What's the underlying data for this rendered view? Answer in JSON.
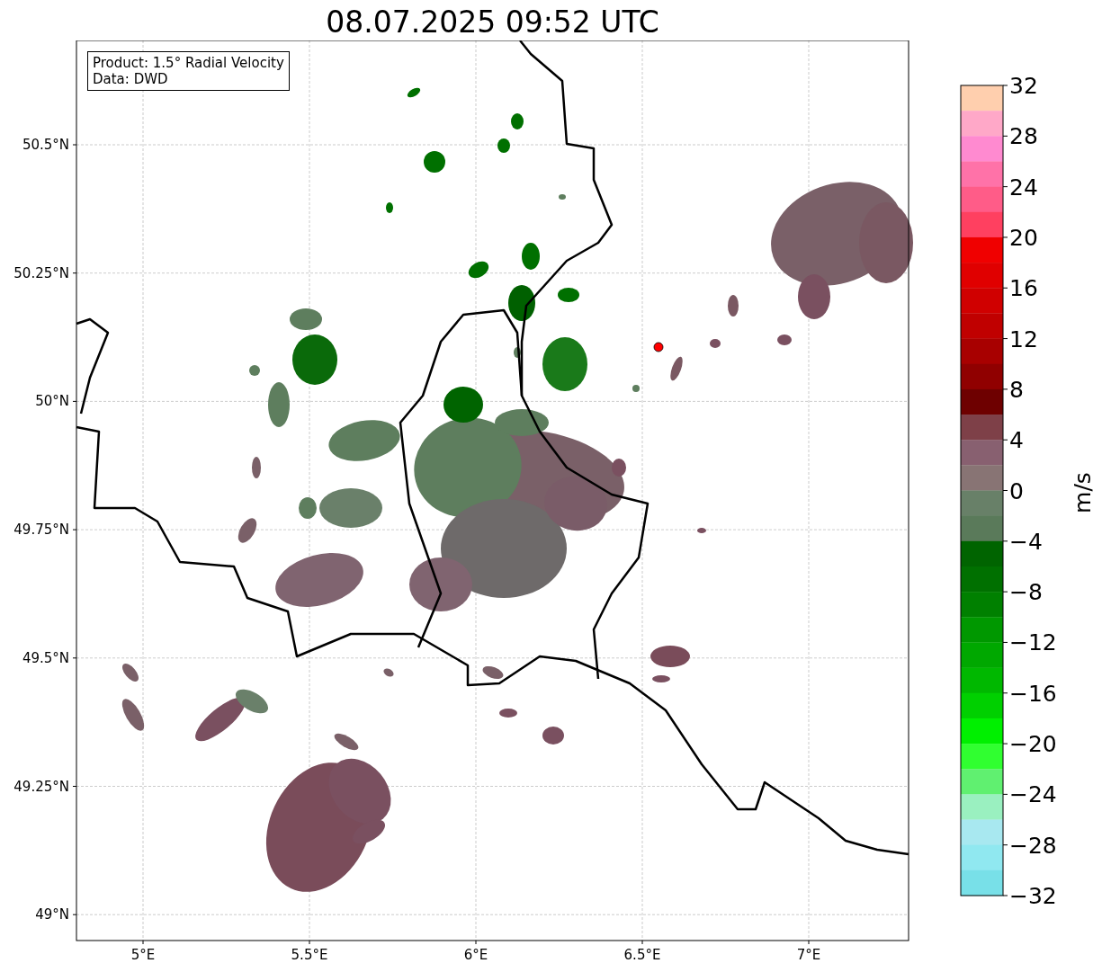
{
  "title": "08.07.2025 09:52 UTC",
  "info_box": {
    "lines": [
      "Product: 1.5° Radial Velocity",
      "Data: DWD"
    ]
  },
  "map": {
    "xtick_labels": [
      "5°E",
      "5.5°E",
      "6°E",
      "6.5°E",
      "7°E"
    ],
    "ytick_labels": [
      "50.5°N",
      "50.25°N",
      "50°N",
      "49.75°N",
      "49.5°N",
      "49.25°N",
      "49°N"
    ]
  },
  "colorbar": {
    "label": "m/s",
    "tick_labels": [
      "32",
      "28",
      "24",
      "20",
      "16",
      "12",
      "8",
      "4",
      "0",
      "−4",
      "−8",
      "−12",
      "−16",
      "−20",
      "−24",
      "−28",
      "−32"
    ],
    "bins": [
      {
        "color": "#ffcfae"
      },
      {
        "color": "#ffa8c8"
      },
      {
        "color": "#ff8ad0"
      },
      {
        "color": "#ff72a8"
      },
      {
        "color": "#ff5c88"
      },
      {
        "color": "#ff4060"
      },
      {
        "color": "#f00000"
      },
      {
        "color": "#e00000"
      },
      {
        "color": "#d00000"
      },
      {
        "color": "#c00000"
      },
      {
        "color": "#a80000"
      },
      {
        "color": "#900000"
      },
      {
        "color": "#6e0000"
      },
      {
        "color": "#7e4048"
      },
      {
        "color": "#886070"
      },
      {
        "color": "#887474"
      },
      {
        "color": "#688068"
      },
      {
        "color": "#5a7a5a"
      },
      {
        "color": "#006400"
      },
      {
        "color": "#007000"
      },
      {
        "color": "#008000"
      },
      {
        "color": "#009800"
      },
      {
        "color": "#00a800"
      },
      {
        "color": "#00b800"
      },
      {
        "color": "#00d000"
      },
      {
        "color": "#00f000"
      },
      {
        "color": "#30ff30"
      },
      {
        "color": "#60f070"
      },
      {
        "color": "#9af0c0"
      },
      {
        "color": "#a8e8f0"
      },
      {
        "color": "#90e8f0"
      },
      {
        "color": "#78e0e8"
      }
    ]
  }
}
